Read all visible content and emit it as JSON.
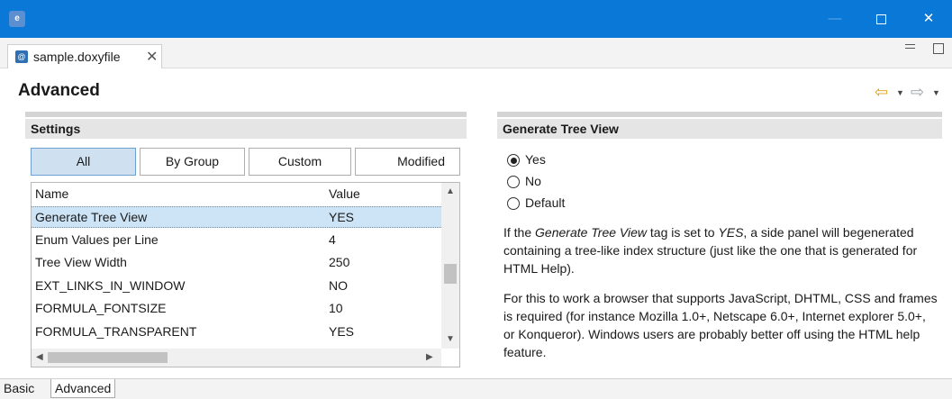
{
  "window": {
    "app_icon_text": "e",
    "minimize_glyph": "—",
    "close_glyph": "✕"
  },
  "editor_tab": {
    "label": "sample.doxyfile",
    "icon_text": "@",
    "close_glyph": "✕"
  },
  "page": {
    "title": "Advanced"
  },
  "nav": {
    "back_glyph": "⇦",
    "forward_glyph": "⇨",
    "dropdown_glyph": "▼"
  },
  "settings": {
    "heading": "Settings",
    "filters": [
      "All",
      "By Group",
      "Custom",
      "Modified"
    ],
    "active_filter": "All",
    "columns": [
      "Name",
      "Value"
    ],
    "rows": [
      {
        "name": "Generate Tree View",
        "value": "YES",
        "selected": true
      },
      {
        "name": "Enum Values per Line",
        "value": "4"
      },
      {
        "name": "Tree View Width",
        "value": "250"
      },
      {
        "name": "EXT_LINKS_IN_WINDOW",
        "value": "NO"
      },
      {
        "name": "FORMULA_FONTSIZE",
        "value": "10"
      },
      {
        "name": "FORMULA_TRANSPARENT",
        "value": "YES"
      }
    ]
  },
  "detail": {
    "heading": "Generate Tree View",
    "options": [
      "Yes",
      "No",
      "Default"
    ],
    "selected_option": "Yes",
    "para1": {
      "t1": "If the ",
      "em1": "Generate Tree View",
      "t2": " tag is set to ",
      "em2": "YES",
      "t3": ", a side panel will begenerated containing a tree-like index structure (just like the one that is generated for HTML Help)."
    },
    "para2": "For this to work a browser that supports JavaScript, DHTML, CSS and frames is required (for instance Mozilla 1.0+, Netscape 6.0+, Internet explorer 5.0+, or Konqueror). Windows users are probably better off using the HTML help feature."
  },
  "bottom_tabs": [
    "Basic",
    "Advanced"
  ],
  "active_bottom_tab": "Advanced",
  "colors": {
    "titlebar": "#0a78d7",
    "selection": "#cde4f7",
    "back_arrow": "#e0a21a"
  }
}
